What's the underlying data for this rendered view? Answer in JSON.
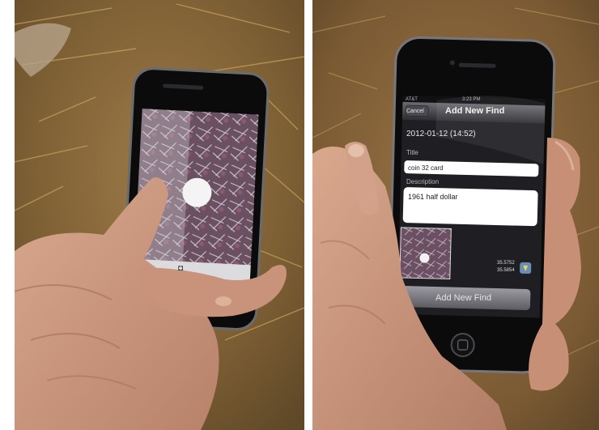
{
  "left_photo": {
    "viewfinder_button": "◘"
  },
  "right_photo": {
    "status_bar": {
      "carrier": "AT&T",
      "time": "3:23 PM"
    },
    "nav": {
      "back_label": "Cancel",
      "title": "Add New Find"
    },
    "timestamp": "2012-01-12 (14:52)",
    "title_label": "Title",
    "title_value": "coin 32 card",
    "description_label": "Description",
    "description_value": "1961 half dollar",
    "coord_lat": "35.5752",
    "coord_lon": "35.5854",
    "submit_label": "Add New Find"
  },
  "colors": {
    "ground": "#8a6a3c",
    "skin": "#c9937a",
    "phone": "#0b0b0c",
    "screen": "#1f1f23",
    "accent_blue": "#6a8fb5"
  }
}
